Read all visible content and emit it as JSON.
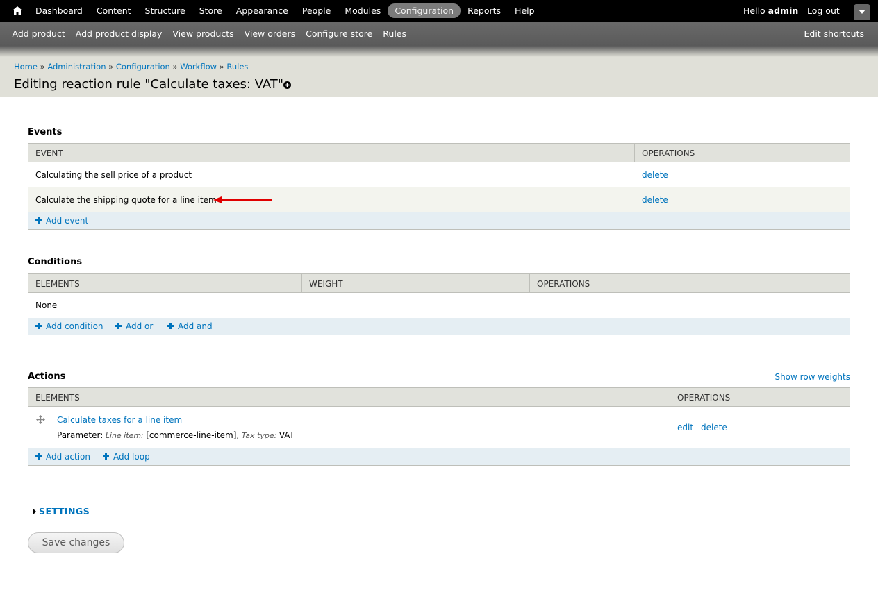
{
  "toolbar": {
    "menu": [
      "Dashboard",
      "Content",
      "Structure",
      "Store",
      "Appearance",
      "People",
      "Modules",
      "Configuration",
      "Reports",
      "Help"
    ],
    "active": "Configuration",
    "hello": "Hello",
    "username": "admin",
    "logout": "Log out"
  },
  "shortcuts": {
    "items": [
      "Add product",
      "Add product display",
      "View products",
      "View orders",
      "Configure store",
      "Rules"
    ],
    "edit": "Edit shortcuts"
  },
  "breadcrumb": [
    "Home",
    "Administration",
    "Configuration",
    "Workflow",
    "Rules"
  ],
  "page_title": "Editing reaction rule \"Calculate taxes: VAT\"",
  "events": {
    "title": "Events",
    "headers": [
      "EVENT",
      "OPERATIONS"
    ],
    "rows": [
      {
        "event": "Calculating the sell price of a product",
        "op": "delete"
      },
      {
        "event": "Calculate the shipping quote for a line item",
        "op": "delete"
      }
    ],
    "add": "Add event"
  },
  "conditions": {
    "title": "Conditions",
    "headers": [
      "ELEMENTS",
      "WEIGHT",
      "OPERATIONS"
    ],
    "none": "None",
    "add": [
      "Add condition",
      "Add or",
      "Add and"
    ]
  },
  "actions": {
    "title": "Actions",
    "show_weights": "Show row weights",
    "headers": [
      "ELEMENTS",
      "OPERATIONS"
    ],
    "row": {
      "name": "Calculate taxes for a line item",
      "param_label": "Parameter:",
      "param1_name": "Line item:",
      "param1_value": "[commerce-line-item],",
      "param2_name": "Tax type:",
      "param2_value": "VAT",
      "edit": "edit",
      "delete": "delete"
    },
    "add": [
      "Add action",
      "Add loop"
    ]
  },
  "settings": "SETTINGS",
  "save": "Save changes",
  "colors": {
    "link": "#0074bd",
    "arrow": "#e00000",
    "active_tab": "#7b7b7b"
  }
}
